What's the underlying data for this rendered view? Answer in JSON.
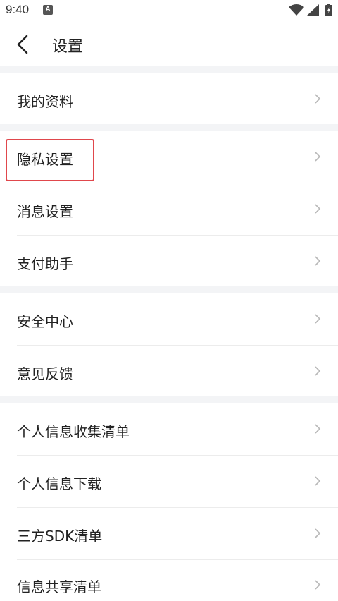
{
  "status_bar": {
    "time": "9:40",
    "notification_icon": "A",
    "icons": [
      "wifi-icon",
      "cell-signal-icon",
      "battery-icon"
    ]
  },
  "header": {
    "title": "设置",
    "back_icon": "chevron-left-icon"
  },
  "menu": {
    "items": [
      {
        "label": "我的资料"
      },
      {
        "label": "隐私设置"
      },
      {
        "label": "消息设置"
      },
      {
        "label": "支付助手"
      },
      {
        "label": "安全中心"
      },
      {
        "label": "意见反馈"
      },
      {
        "label": "个人信息收集清单"
      },
      {
        "label": "个人信息下载"
      },
      {
        "label": "三方SDK清单"
      },
      {
        "label": "信息共享清单"
      }
    ]
  },
  "colors": {
    "background": "#ffffff",
    "section_gap": "#f3f4f6",
    "highlight": "#e0474c",
    "chevron": "#b8b8b8"
  }
}
